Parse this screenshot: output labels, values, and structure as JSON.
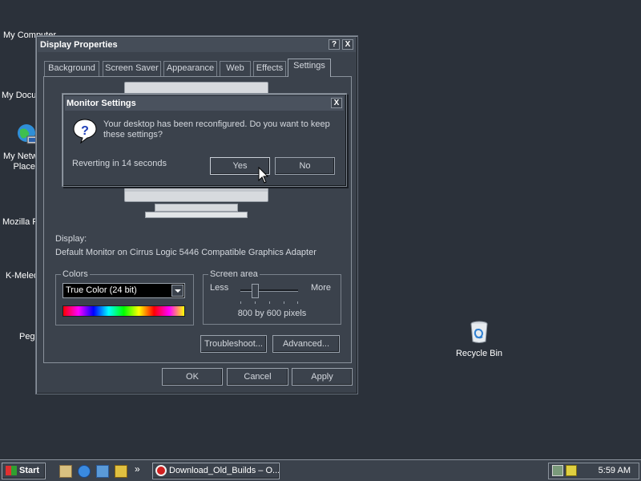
{
  "desktop": {
    "icons": [
      {
        "label": "My Computer"
      },
      {
        "label": "My Documents"
      },
      {
        "label": "My Network Places"
      },
      {
        "label": "Mozilla Firefox"
      },
      {
        "label": "K-Meleon"
      },
      {
        "label": "Pegasus"
      },
      {
        "label": "Recycle Bin"
      }
    ]
  },
  "window": {
    "title": "Display Properties",
    "help_btn": "?",
    "close_btn": "X",
    "tabs": [
      "Background",
      "Screen Saver",
      "Appearance",
      "Web",
      "Effects",
      "Settings"
    ],
    "active_tab": "Settings",
    "display_label": "Display:",
    "display_value": "Default Monitor on Cirrus Logic 5446 Compatible Graphics Adapter",
    "colors": {
      "label": "Colors",
      "selected": "True Color (24 bit)"
    },
    "screen_area": {
      "label": "Screen area",
      "less": "Less",
      "more": "More",
      "value": "800 by 600 pixels",
      "slider_level": 0.25
    },
    "troubleshoot": "Troubleshoot...",
    "advanced": "Advanced...",
    "ok": "OK",
    "cancel": "Cancel",
    "apply": "Apply"
  },
  "dialog": {
    "title": "Monitor Settings",
    "close_btn": "X",
    "message": "Your desktop has been reconfigured.  Do you want to keep these settings?",
    "countdown": "Reverting in 14 seconds",
    "yes": "Yes",
    "no": "No"
  },
  "taskbar": {
    "start": "Start",
    "task": "Download_Old_Builds – O...",
    "clock": "5:59 AM",
    "overflow": "»"
  },
  "colors": {
    "desktop": "#2b313a",
    "window": "#3b424c",
    "accent": "#454d58"
  }
}
